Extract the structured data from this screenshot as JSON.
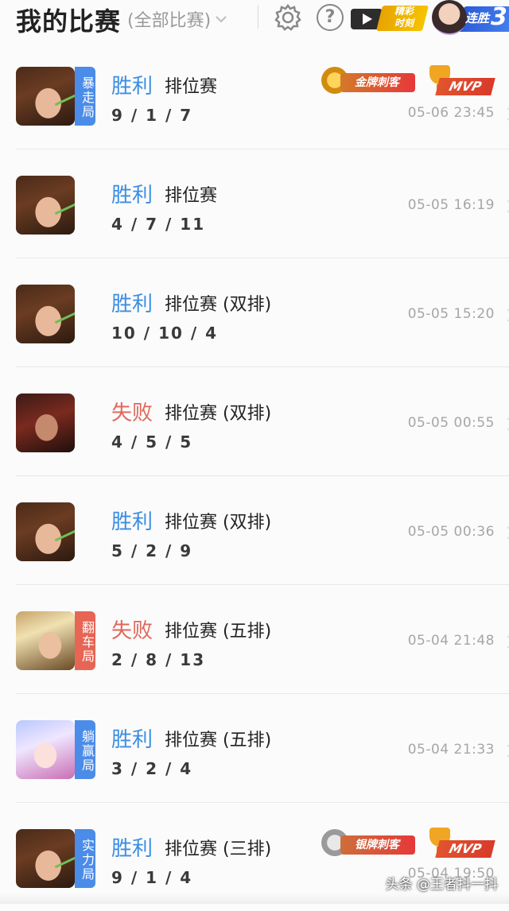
{
  "header": {
    "title": "我的比赛",
    "filter_label": "(全部比赛)",
    "highlight_label_1": "精彩",
    "highlight_label_2": "时刻",
    "streak_label": "连胜",
    "streak_count": "3"
  },
  "matches": [
    {
      "result": "胜利",
      "mode": "排位赛",
      "kda": "9 / 1 / 7",
      "time": "05-06 23:45",
      "tag": "暴走局",
      "medal": "金牌刺客",
      "mvp": "MVP"
    },
    {
      "result": "胜利",
      "mode": "排位赛",
      "kda": "4 / 7 / 11",
      "time": "05-05 16:19"
    },
    {
      "result": "胜利",
      "mode": "排位赛 (双排)",
      "kda": "10 / 10 / 4",
      "time": "05-05 15:20"
    },
    {
      "result": "失败",
      "mode": "排位赛 (双排)",
      "kda": "4 / 5 / 5",
      "time": "05-05 00:55"
    },
    {
      "result": "胜利",
      "mode": "排位赛 (双排)",
      "kda": "5 / 2 / 9",
      "time": "05-05 00:36"
    },
    {
      "result": "失败",
      "mode": "排位赛 (五排)",
      "kda": "2 / 8 / 13",
      "time": "05-04 21:48",
      "tag": "翻车局"
    },
    {
      "result": "胜利",
      "mode": "排位赛 (五排)",
      "kda": "3 / 2 / 4",
      "time": "05-04 21:33",
      "tag": "躺赢局"
    },
    {
      "result": "胜利",
      "mode": "排位赛 (三排)",
      "kda": "9 / 1 / 4",
      "time": "05-04 19:50",
      "tag": "实力局",
      "medal": "银牌刺客",
      "mvp": "MVP"
    }
  ],
  "watermark": "头条 @王者抖一抖",
  "colors": {
    "win": "#3b8ee3",
    "lose": "#e0685a",
    "tag_blue": "#4b8ce8",
    "tag_red": "#e76555"
  }
}
